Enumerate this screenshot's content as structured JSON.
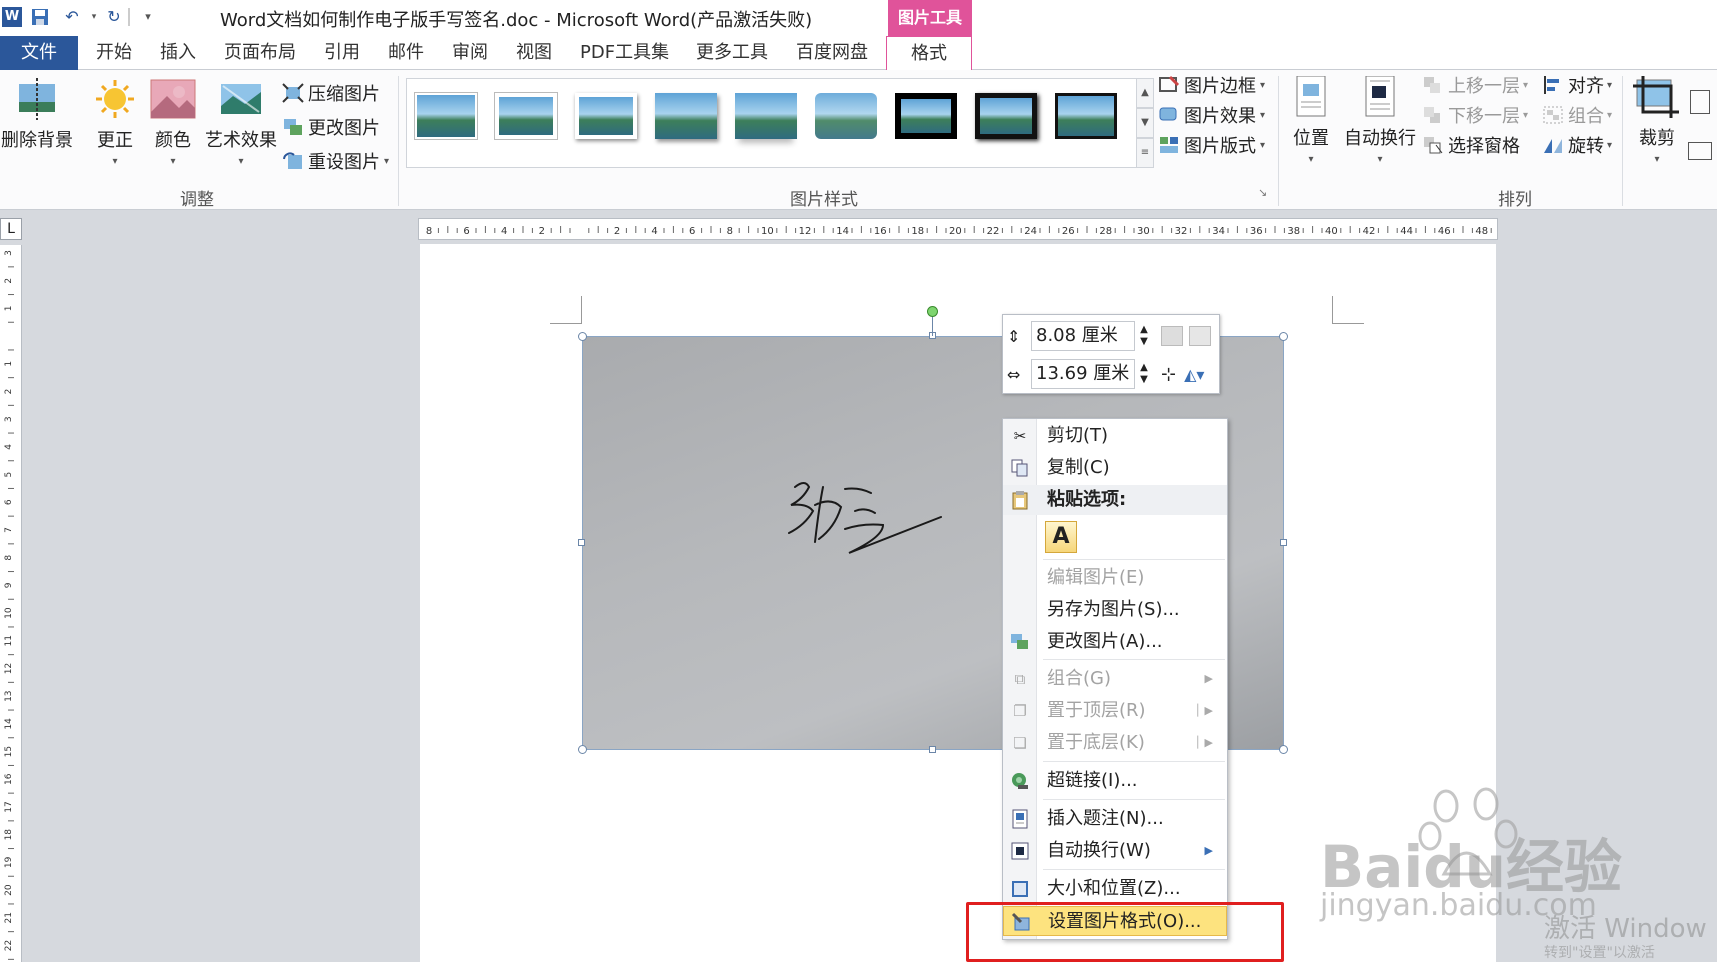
{
  "window": {
    "title": "Word文档如何制作电子版手写签名.doc - Microsoft Word(产品激活失败)",
    "context_tab_header": "图片工具"
  },
  "tabs": {
    "file": "文件",
    "items": [
      "开始",
      "插入",
      "页面布局",
      "引用",
      "邮件",
      "审阅",
      "视图",
      "PDF工具集",
      "更多工具",
      "百度网盘"
    ],
    "active_context_tab": "格式"
  },
  "ribbon": {
    "adjust": {
      "remove_bg": "删除背景",
      "correct": "更正",
      "color": "颜色",
      "artistic": "艺术效果",
      "compress": "压缩图片",
      "change": "更改图片",
      "reset": "重设图片",
      "group_label": "调整"
    },
    "styles": {
      "border": "图片边框",
      "effects": "图片效果",
      "layout": "图片版式",
      "group_label": "图片样式"
    },
    "arrange": {
      "position": "位置",
      "wrap": "自动换行",
      "bring_forward": "上移一层",
      "send_backward": "下移一层",
      "selection_pane": "选择窗格",
      "align": "对齐",
      "group": "组合",
      "rotate": "旋转",
      "group_label": "排列"
    },
    "size": {
      "crop": "裁剪"
    }
  },
  "ruler": {
    "corner": "L",
    "h_labels": [
      "8",
      "6",
      "4",
      "2",
      "",
      "2",
      "4",
      "6",
      "8",
      "10",
      "12",
      "14",
      "16",
      "18",
      "20",
      "22",
      "24",
      "26",
      "28",
      "30",
      "32",
      "34",
      "36",
      "38",
      "40",
      "42",
      "44",
      "46",
      "48"
    ],
    "v_labels": [
      "3",
      "2",
      "1",
      "",
      "1",
      "2",
      "3",
      "4",
      "5",
      "6",
      "7",
      "8",
      "9",
      "10",
      "11",
      "12",
      "13",
      "14",
      "15",
      "16",
      "17",
      "18",
      "19",
      "20",
      "21",
      "22"
    ]
  },
  "picture": {
    "signature_text": "张三"
  },
  "mini_toolbar": {
    "height_value": "8.08 厘米",
    "width_value": "13.69 厘米"
  },
  "context_menu": {
    "cut": "剪切(T)",
    "copy": "复制(C)",
    "paste_options": "粘贴选项:",
    "paste_keep_text": "A",
    "edit_picture": "编辑图片(E)",
    "save_as_picture": "另存为图片(S)...",
    "change_picture": "更改图片(A)...",
    "group": "组合(G)",
    "bring_to_front": "置于顶层(R)",
    "send_to_back": "置于底层(K)",
    "hyperlink": "超链接(I)...",
    "insert_caption": "插入题注(N)...",
    "wrap_text": "自动换行(W)",
    "size_position": "大小和位置(Z)...",
    "format_picture": "设置图片格式(O)..."
  },
  "overlay": {
    "watermark_brand": "Baidu经验",
    "watermark_url": "jingyan.baidu.com",
    "activate_text": "激活 Window",
    "activate_sub": "转到\"设置\"以激活"
  },
  "colors": {
    "file_tab": "#2b579a",
    "context_tab": "#e0539a",
    "menu_highlight": "#fde37f",
    "callout_box": "#e01f1f"
  }
}
